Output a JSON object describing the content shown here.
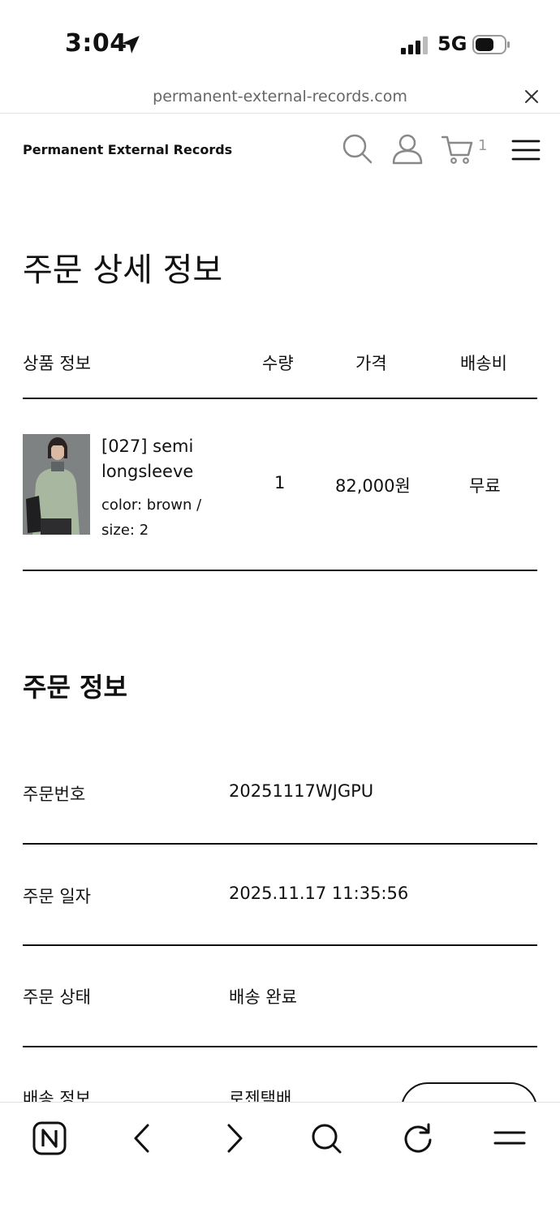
{
  "status_bar": {
    "time": "3:04",
    "network": "5G"
  },
  "url_bar": {
    "url": "permanent-external-records.com"
  },
  "header": {
    "brand": "Permanent External Records",
    "cart_count": "1"
  },
  "page": {
    "title": "주문 상세 정보"
  },
  "product_table": {
    "headers": [
      "상품 정보",
      "수량",
      "가격",
      "배송비"
    ],
    "rows": [
      {
        "name": "[027] semi longsleeve",
        "options": "color: brown / size: 2",
        "quantity": "1",
        "price": "82,000원",
        "shipping": "무료"
      }
    ]
  },
  "order_info": {
    "title": "주문 정보",
    "rows": [
      {
        "label": "주문번호",
        "value": "20251117WJGPU"
      },
      {
        "label": "주문 일자",
        "value": "2025.11.17 11:35:56"
      },
      {
        "label": "주문 상태",
        "value": "배송 완료"
      },
      {
        "label": "배송 정보",
        "value": "로젠택배"
      }
    ]
  }
}
